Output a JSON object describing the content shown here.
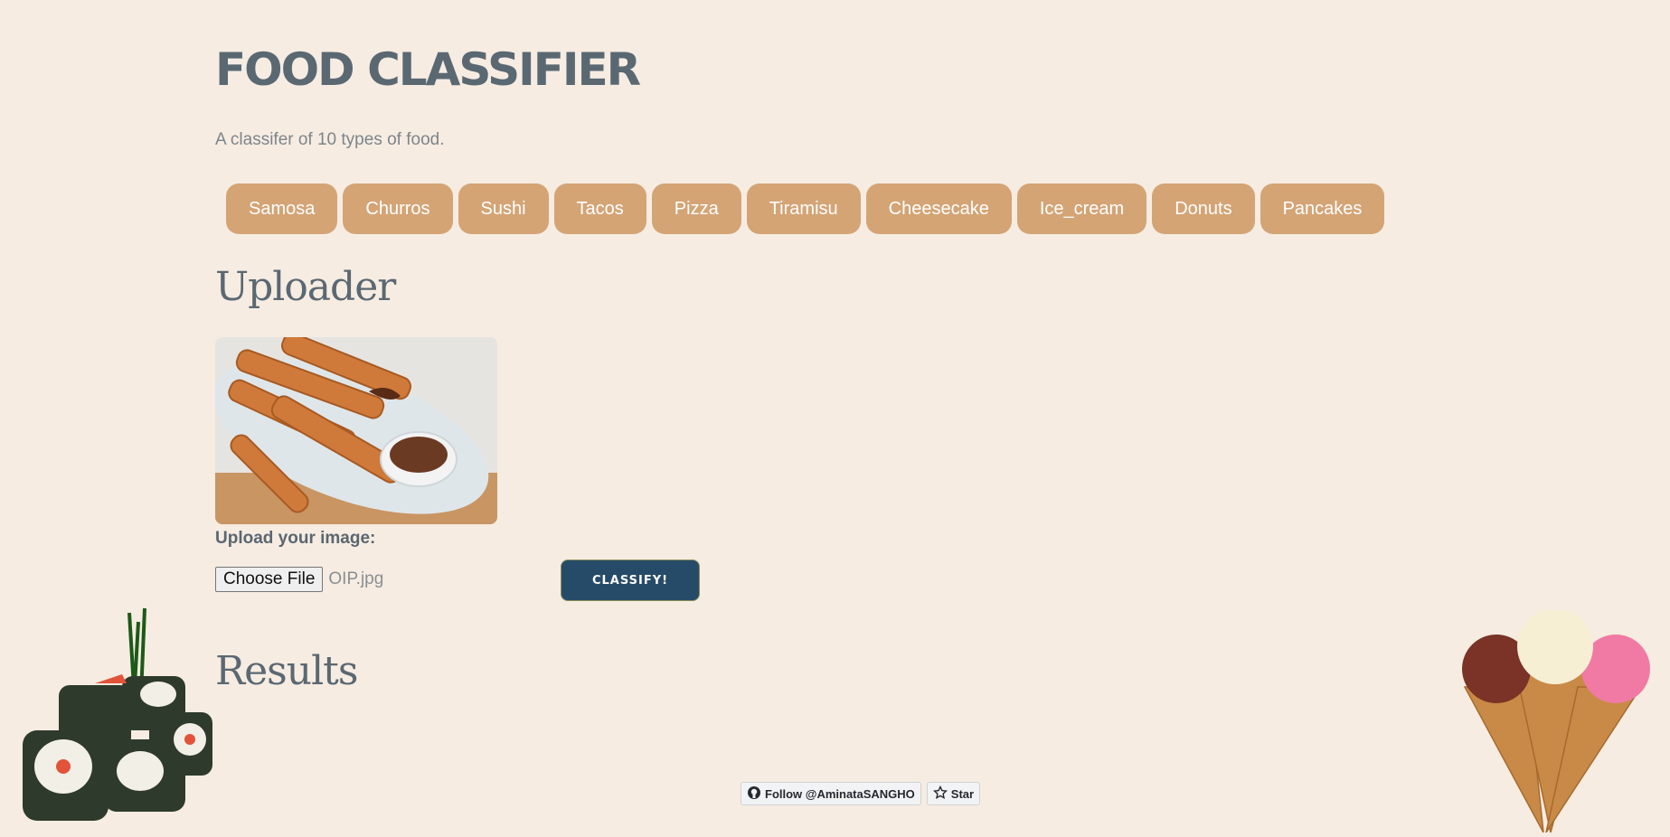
{
  "header": {
    "title": "FOOD CLASSIFIER",
    "subtitle": "A classifer of 10 types of food."
  },
  "food_tags": [
    "Samosa",
    "Churros",
    "Sushi",
    "Tacos",
    "Pizza",
    "Tiramisu",
    "Cheesecake",
    "Ice_cream",
    "Donuts",
    "Pancakes"
  ],
  "uploader": {
    "title": "Uploader",
    "upload_label": "Upload your image:",
    "choose_file_label": "Choose File",
    "file_name": "OIP.jpg",
    "classify_label": "CLASSIFY!"
  },
  "results": {
    "title": "Results"
  },
  "footer": {
    "follow_label": "Follow @AminataSANGHO",
    "star_label": "Star"
  },
  "colors": {
    "background": "#f6ece2",
    "tag": "#d4a475",
    "classify": "#264b68"
  }
}
